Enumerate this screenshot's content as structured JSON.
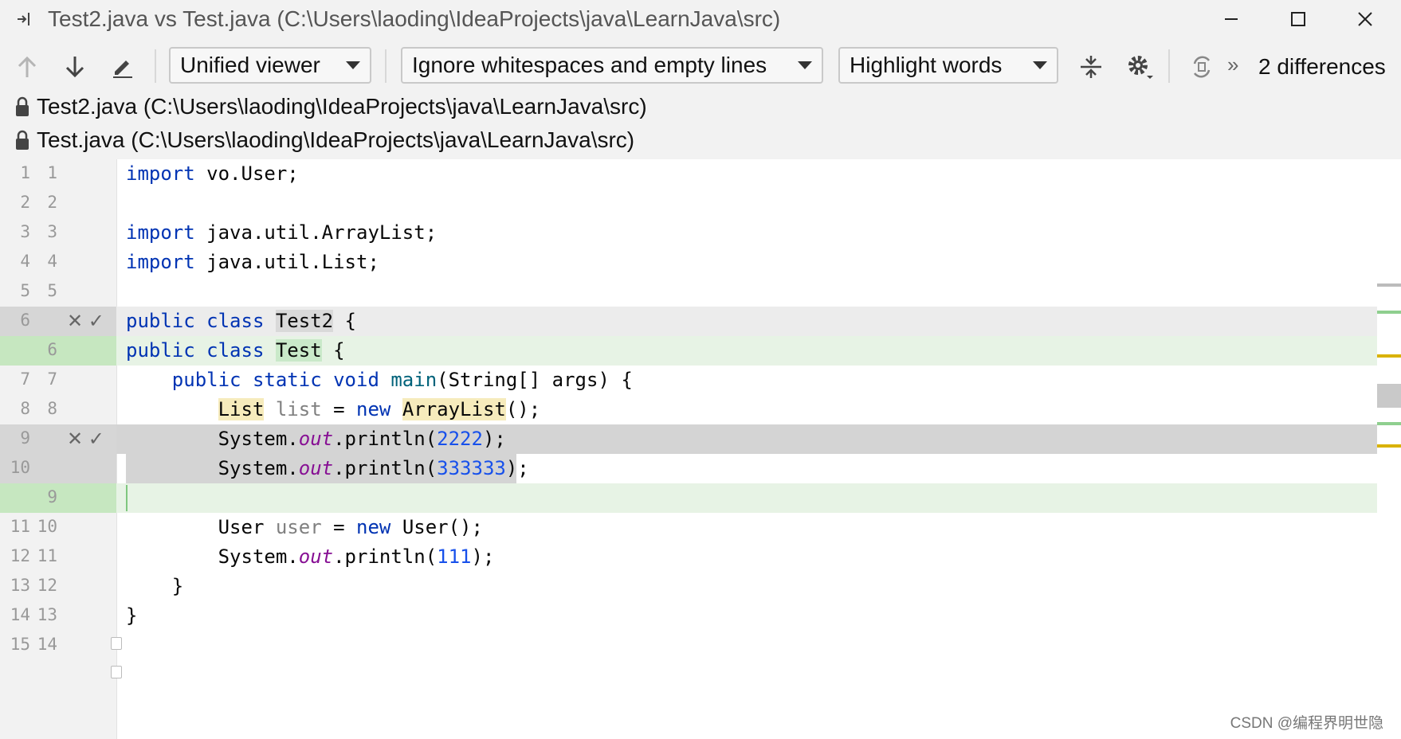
{
  "window": {
    "title": "Test2.java vs Test.java (C:\\Users\\laoding\\IdeaProjects\\java\\LearnJava\\src)"
  },
  "toolbar": {
    "viewer": "Unified viewer",
    "whitespace": "Ignore whitespaces and empty lines",
    "highlight": "Highlight words",
    "differences": "2 differences",
    "more": "»"
  },
  "files": {
    "left": "Test2.java (C:\\Users\\laoding\\IdeaProjects\\java\\LearnJava\\src)",
    "right": "Test.java (C:\\Users\\laoding\\IdeaProjects\\java\\LearnJava\\src)"
  },
  "lines": [
    {
      "n1": "1",
      "n2": "1"
    },
    {
      "n1": "2",
      "n2": "2"
    },
    {
      "n1": "3",
      "n2": "3"
    },
    {
      "n1": "4",
      "n2": "4"
    },
    {
      "n1": "5",
      "n2": "5"
    },
    {
      "n1": "6",
      "n2": "",
      "marks": "✕ ✓"
    },
    {
      "n1": "",
      "n2": "6"
    },
    {
      "n1": "7",
      "n2": "7"
    },
    {
      "n1": "8",
      "n2": "8"
    },
    {
      "n1": "9",
      "n2": "",
      "marks": "✕ ✓"
    },
    {
      "n1": "10",
      "n2": ""
    },
    {
      "n1": "",
      "n2": "9"
    },
    {
      "n1": "11",
      "n2": "10"
    },
    {
      "n1": "12",
      "n2": "11"
    },
    {
      "n1": "13",
      "n2": "12"
    },
    {
      "n1": "14",
      "n2": "13"
    },
    {
      "n1": "15",
      "n2": "14"
    }
  ],
  "code": {
    "import_kw": "import",
    "l1": " vo.User;",
    "l3": " java.util.ArrayList;",
    "l4": " java.util.List;",
    "public": "public",
    "class": "class",
    "static": "static",
    "void": "void",
    "new": "new",
    "test2": "Test2",
    "test": "Test",
    "brace_open": " {",
    "main": "main",
    "main_args": "(String[] args) {",
    "list_type": "List",
    "list_var": "list",
    "eq": " = ",
    "arraylist": "ArrayList",
    "call_end": "();",
    "system": "System.",
    "out": "out",
    "println": ".println(",
    "n2222": "2222",
    "n333333": "333333",
    "n111": "111",
    "close_call": ");",
    "user_type": "User",
    "user_var": "user",
    "user_ctor": "User();",
    "close_brace": "}"
  },
  "watermark": "CSDN @编程界明世隐"
}
